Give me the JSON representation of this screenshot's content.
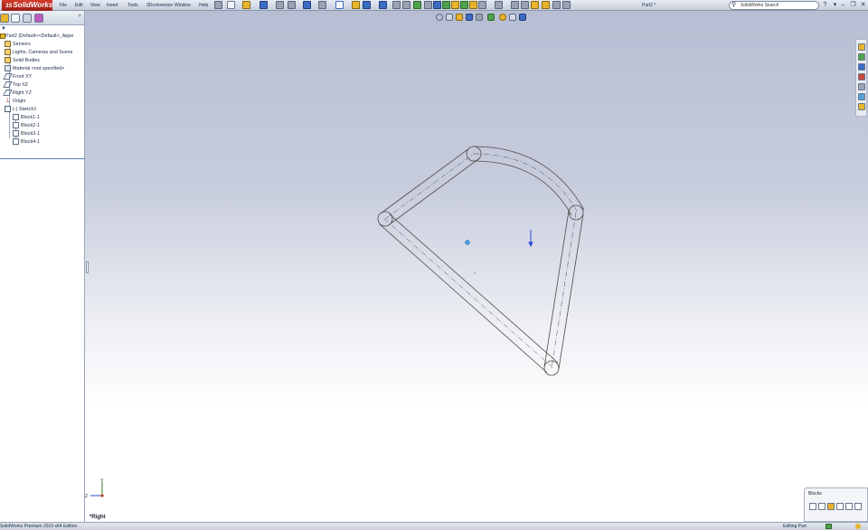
{
  "app": {
    "logo": "SolidWorks",
    "doc_title": "Part2 *",
    "search_placeholder": "SolidWorks Search"
  },
  "menu": [
    {
      "label": "File"
    },
    {
      "label": "Edit"
    },
    {
      "label": "View"
    },
    {
      "label": "Insert"
    },
    {
      "label": "Tools"
    },
    {
      "label": "3Dconnexion"
    },
    {
      "label": "Window"
    },
    {
      "label": "Help"
    }
  ],
  "tree": {
    "root": "Part2 (Default<<Default>_Appe",
    "items": [
      {
        "label": "Sensors",
        "icon": "sensor-icon"
      },
      {
        "label": "Lights, Cameras and Scene",
        "icon": "lights-icon"
      },
      {
        "label": "Solid Bodies",
        "icon": "solid-bodies-icon"
      },
      {
        "label": "Material <not specified>",
        "icon": "material-icon"
      },
      {
        "label": "Front XY",
        "icon": "plane-icon"
      },
      {
        "label": "Top XZ",
        "icon": "plane-icon"
      },
      {
        "label": "Right YZ",
        "icon": "plane-icon"
      },
      {
        "label": "Origin",
        "icon": "origin-icon"
      },
      {
        "label": "(-) Sketch1",
        "icon": "sketch-icon"
      },
      {
        "label": "Block1-1",
        "icon": "block-icon"
      },
      {
        "label": "Block2-1",
        "icon": "block-icon"
      },
      {
        "label": "Block3-1",
        "icon": "block-icon"
      },
      {
        "label": "Block4-1",
        "icon": "block-icon"
      }
    ]
  },
  "viewport": {
    "view_name": "*Right",
    "triad_labels": {
      "y": "Y",
      "z": "Z"
    }
  },
  "blocks_panel": {
    "title": "Blocks"
  },
  "status": {
    "edition": "SolidWorks Premium 2010 x64 Edition",
    "mode": "Editing Part"
  },
  "colors": {
    "brand": "#c0392b",
    "accent": "#3b6cc4",
    "sketch_line": "#4a4a4a"
  }
}
